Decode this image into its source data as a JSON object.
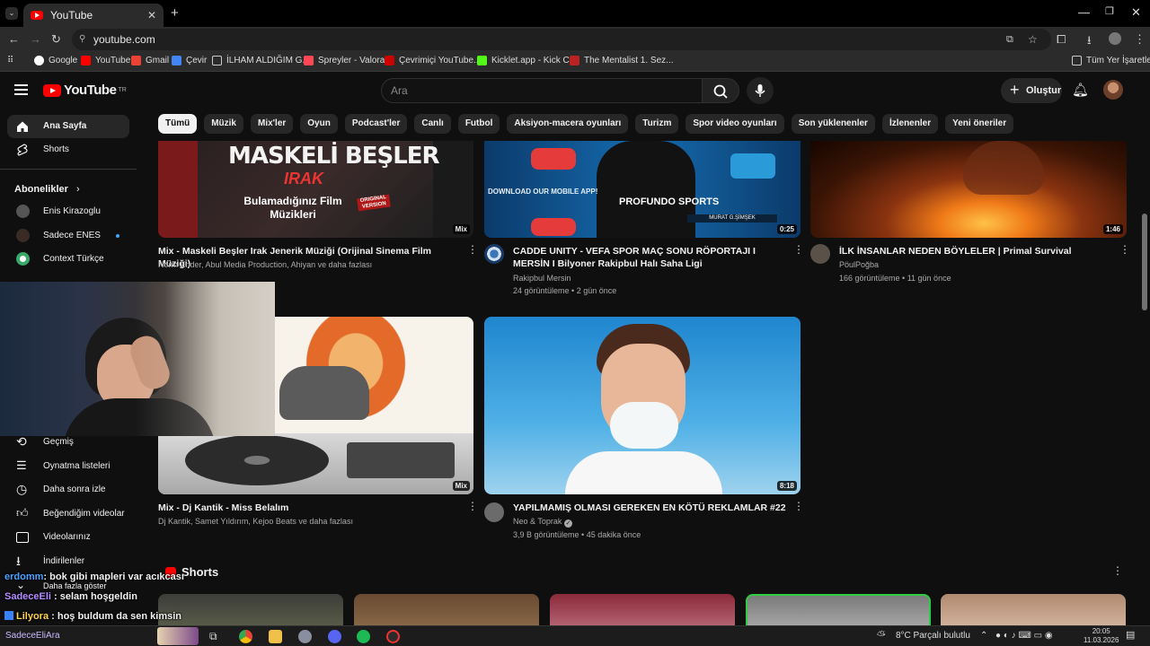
{
  "browser": {
    "tab_title": "YouTube",
    "new_tab": "+",
    "url": "youtube.com",
    "bookmarks": [
      "Google",
      "YouTube",
      "Gmail",
      "Çevir",
      "İLHAM ALDIĞIM G...",
      "Spreyler - Valorant",
      "Çevrimiçi YouTube...",
      "Kicklet.app - Kick C...",
      "The Mentalist 1. Sez..."
    ],
    "all_bookmarks": "Tüm Yer İşaretleri"
  },
  "header": {
    "logo": "YouTube",
    "logo_region": "TR",
    "search_placeholder": "Ara",
    "create_label": "Oluştur"
  },
  "chips": [
    "Tümü",
    "Müzik",
    "Mix'ler",
    "Oyun",
    "Podcast'ler",
    "Canlı",
    "Futbol",
    "Aksiyon-macera oyunları",
    "Turizm",
    "Spor video oyunları",
    "Son yüklenenler",
    "İzlenenler",
    "Yeni öneriler"
  ],
  "sidebar": {
    "home": "Ana Sayfa",
    "shorts": "Shorts",
    "subscriptions_heading": "Abonelikler",
    "subscriptions": [
      "Enis Kirazoglu",
      "Sadece ENES",
      "Context Türkçe"
    ],
    "library": [
      "Geçmiş",
      "Oynatma listeleri",
      "Daha sonra izle",
      "Beğendiğim videolar",
      "Videolarınız",
      "İndirilenler"
    ],
    "show_more": "Daha fazla göster"
  },
  "videos": [
    {
      "title": "Mix - Maskeli Beşler Irak Jenerik Müziği (Orijinal Sinema Film Müziği)",
      "channel": "Norm Ender, Abul Media Production, Ahiyan ve daha fazlası",
      "stats": "",
      "badge": "Mix",
      "thumb_text": "MASKELİ BEŞLER",
      "thumb_sub": "IRAK",
      "thumb_caption": "Bulamadığınız Film Müzikleri",
      "thumb_stamp": "ORIGINAL VERSION"
    },
    {
      "title": "CADDE UNITY - VEFA SPOR  MAÇ SONU RÖPORTAJI I MERSİN I Bilyoner Rakipbul Halı Saha Ligi",
      "channel": "Rakipbul Mersin",
      "stats": "24 görüntüleme • 2 gün önce",
      "badge": "0:25",
      "thumb_text": "DOWNLOAD OUR MOBILE APP!",
      "thumb_sub": "PROFUNDO SPORTS",
      "thumb_caption": "MURAT G.ŞİMŞEK"
    },
    {
      "title": "İLK İNSANLAR NEDEN BÖYLELER | Primal Survival",
      "channel": "PöulPoğba",
      "stats": "166 görüntüleme • 11 gün önce",
      "badge": "1:46"
    },
    {
      "title": "Mix - Dj Kantik - Miss Belalım",
      "channel": "Dj Kantik, Samet Yıldırım, Kejoo Beats ve daha fazlası",
      "stats": "",
      "badge": "Mix"
    },
    {
      "title": "YAPILMAMIŞ OLMASI GEREKEN EN KÖTÜ REKLAMLAR #22",
      "channel": "Neo & Toprak",
      "stats": "3,9 B görüntüleme • 45 dakika önce",
      "badge": "8:18"
    }
  ],
  "shorts_heading": "Shorts",
  "chat": [
    {
      "user": "erdomm",
      "msg": ": bok gibi mapleri var acıkcası",
      "color": "#4aa3ff"
    },
    {
      "user": "SadeceEli",
      "msg": " : selam hoşgeldin",
      "color": "#b58cff"
    },
    {
      "user": "Lilyora",
      "msg": " : hoş buldum da sen kimsin",
      "color": "#ffd24a"
    }
  ],
  "taskbar": {
    "search_text": "SadeceEliAra",
    "weather": "8°C  Parçalı bulutlu",
    "time": "20:05",
    "date": "11.03.2026"
  }
}
